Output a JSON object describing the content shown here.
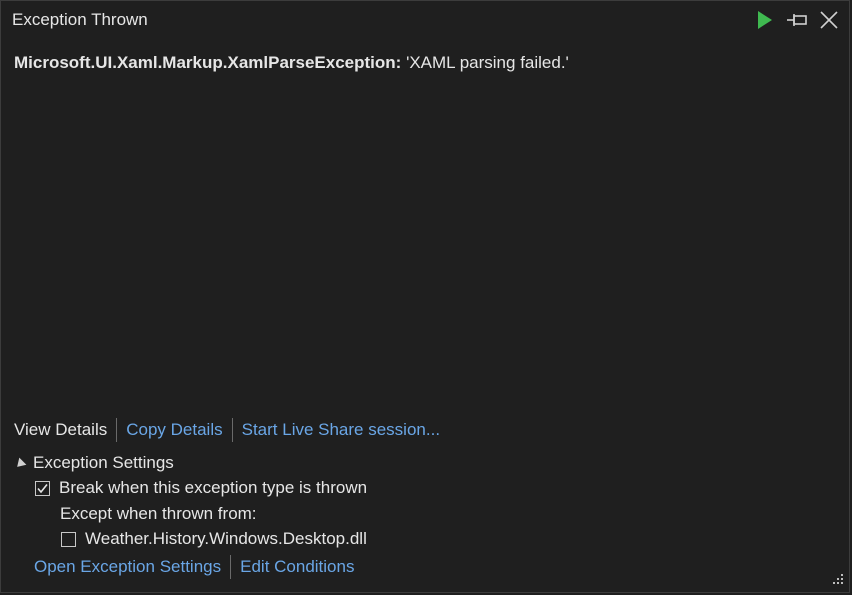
{
  "window": {
    "title": "Exception Thrown",
    "icons": [
      "play-icon",
      "pin-icon",
      "close-icon"
    ],
    "accent_play": "#3fb950",
    "link_color": "#6aa6e6"
  },
  "exception": {
    "type": "Microsoft.UI.Xaml.Markup.XamlParseException:",
    "message": "'XAML parsing failed.'"
  },
  "actions": {
    "view_details": "View Details",
    "copy_details": "Copy Details",
    "live_share": "Start Live Share session..."
  },
  "settings": {
    "header": "Exception Settings",
    "break_label": "Break when this exception type is thrown",
    "break_checked": true,
    "except_label": "Except when thrown from:",
    "module_label": "Weather.History.Windows.Desktop.dll",
    "module_checked": false,
    "open_settings": "Open Exception Settings",
    "edit_conditions": "Edit Conditions"
  }
}
